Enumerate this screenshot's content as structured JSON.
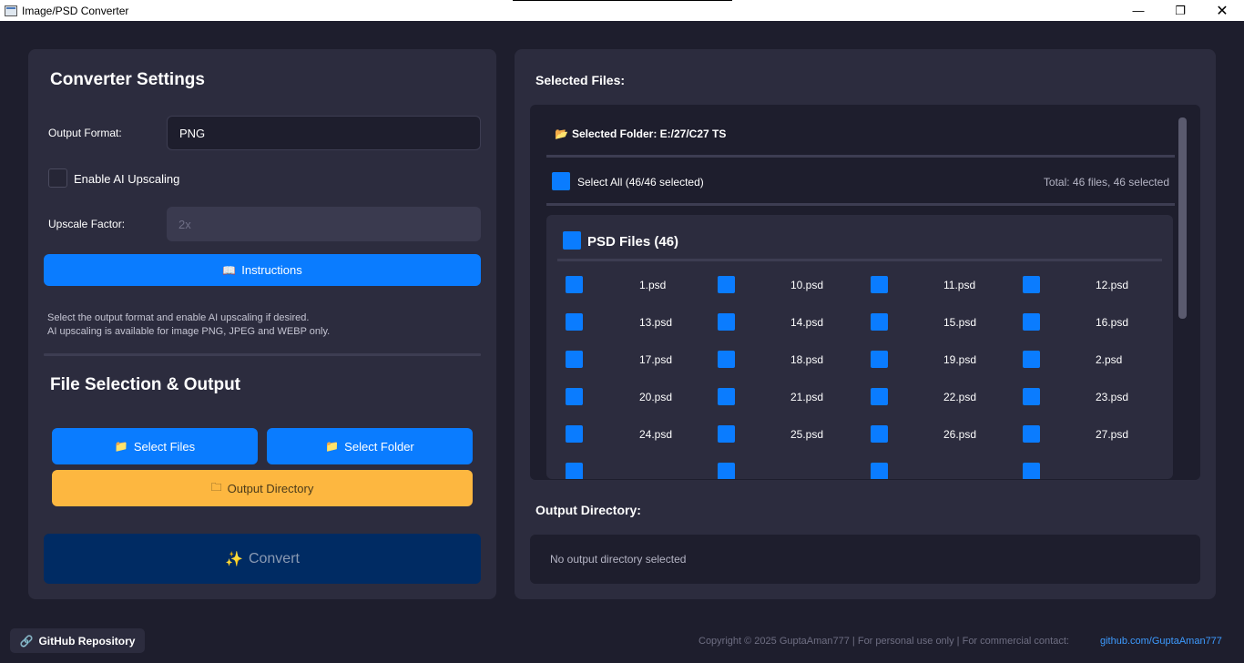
{
  "window": {
    "title": "Image/PSD Converter",
    "minimize_glyph": "—",
    "maximize_glyph": "❐",
    "close_glyph": "✕"
  },
  "settings": {
    "heading": "Converter Settings",
    "output_format_label": "Output Format:",
    "output_format_value": "PNG",
    "ai_upscaling_label": "Enable AI Upscaling",
    "ai_upscaling_checked": false,
    "upscale_factor_label": "Upscale Factor:",
    "upscale_factor_placeholder": "2x",
    "instructions_label": "Instructions",
    "instructions_icon": "book-icon",
    "help_line1": "Select the output format and enable AI upscaling if desired.",
    "help_line2": "AI upscaling is available for image PNG, JPEG and WEBP only."
  },
  "file_selection": {
    "heading": "File Selection & Output",
    "select_files_label": "Select Files",
    "select_folder_label": "Select Folder",
    "output_directory_label": "Output Directory",
    "convert_label": "Convert",
    "convert_icon": "sparkles-icon"
  },
  "selected_files": {
    "heading": "Selected Files:",
    "folder_label": "Selected Folder: E:/27/C27 TS",
    "select_all_label": "Select All (46/46 selected)",
    "total_label": "Total: 46 files, 46 selected",
    "group_title": "PSD Files (46)",
    "files": [
      "1.psd",
      "10.psd",
      "11.psd",
      "12.psd",
      "13.psd",
      "14.psd",
      "15.psd",
      "16.psd",
      "17.psd",
      "18.psd",
      "19.psd",
      "2.psd",
      "20.psd",
      "21.psd",
      "22.psd",
      "23.psd",
      "24.psd",
      "25.psd",
      "26.psd",
      "27.psd"
    ]
  },
  "output_directory": {
    "heading": "Output Directory:",
    "value": "No output directory selected"
  },
  "footer": {
    "github_button": "GitHub Repository",
    "copyright": "Copyright © 2025 GuptaAman777 | For personal use only | For commercial contact:",
    "github_link": "github.com/GuptaAman777"
  },
  "colors": {
    "accent_blue": "#0a7cff",
    "accent_orange": "#fdb740",
    "convert_disabled": "#002b63",
    "panel_bg": "#2c2c3e",
    "app_bg": "#1e1e2d"
  }
}
